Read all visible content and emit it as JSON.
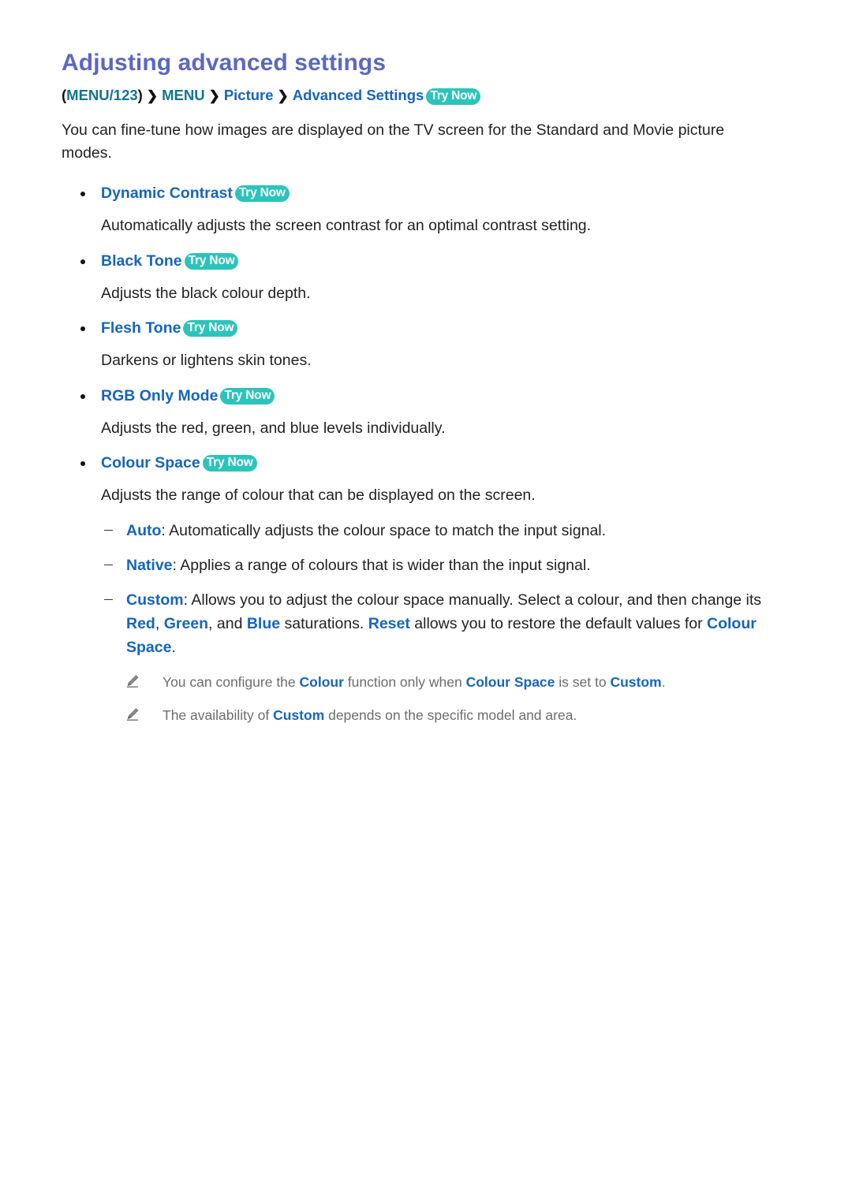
{
  "page": {
    "title": "Adjusting advanced settings",
    "try_now_label": "Try Now"
  },
  "breadcrumb": {
    "open_paren": "(",
    "menu123": "MENU/123",
    "close_paren": ")",
    "separator": "❯",
    "menu": "MENU",
    "picture": "Picture",
    "advanced_settings": "Advanced Settings",
    "try_now_label": "Try Now"
  },
  "intro": "You can fine-tune how images are displayed on the TV screen for the Standard and Movie picture modes.",
  "bullets": [
    {
      "heading": "Dynamic Contrast",
      "try_now_label": "Try Now",
      "description": "Automatically adjusts the screen contrast for an optimal contrast setting."
    },
    {
      "heading": "Black Tone",
      "try_now_label": "Try Now",
      "description": "Adjusts the black colour depth."
    },
    {
      "heading": "Flesh Tone",
      "try_now_label": "Try Now",
      "description": "Darkens or lightens skin tones."
    },
    {
      "heading": "RGB Only Mode",
      "try_now_label": "Try Now",
      "description": "Adjusts the red, green, and blue levels individually."
    },
    {
      "heading": "Colour Space",
      "try_now_label": "Try Now",
      "description": "Adjusts the range of colour that can be displayed on the screen."
    }
  ],
  "colour_space_options": {
    "auto": {
      "keyword": "Auto",
      "colon": ":",
      "text": " Automatically adjusts the colour space to match the input signal."
    },
    "native": {
      "keyword": "Native",
      "colon": ":",
      "text": " Applies a range of colours that is wider than the input signal."
    },
    "custom": {
      "keyword": "Custom",
      "colon": ":",
      "text_1": " Allows you to adjust the colour space manually. Select a colour, and then change its ",
      "kw_red": "Red",
      "comma_1": ", ",
      "kw_green": "Green",
      "text_2": ", and ",
      "kw_blue": "Blue",
      "text_3": " saturations. ",
      "kw_reset": "Reset",
      "text_4": " allows you to restore the default values for ",
      "kw_colour_space": "Colour Space",
      "period": "."
    }
  },
  "notes": [
    {
      "icon": "pencil-icon",
      "text_1": "You can configure the ",
      "kw_1": "Colour",
      "text_2": " function only when ",
      "kw_2": "Colour Space",
      "text_3": " is set to ",
      "kw_3": "Custom",
      "text_4": "."
    },
    {
      "icon": "pencil-icon",
      "text_1": "The availability of ",
      "kw_1": "Custom",
      "text_2": " depends on the specific model and area.",
      "kw_2": "",
      "text_3": "",
      "kw_3": "",
      "text_4": ""
    }
  ],
  "colors": {
    "title": "#5b68c0",
    "teal": "#12758f",
    "blue": "#1565c0",
    "badge_bg": "#2bc4bb",
    "body_text": "#222222",
    "note_text": "#6d6d6d"
  }
}
